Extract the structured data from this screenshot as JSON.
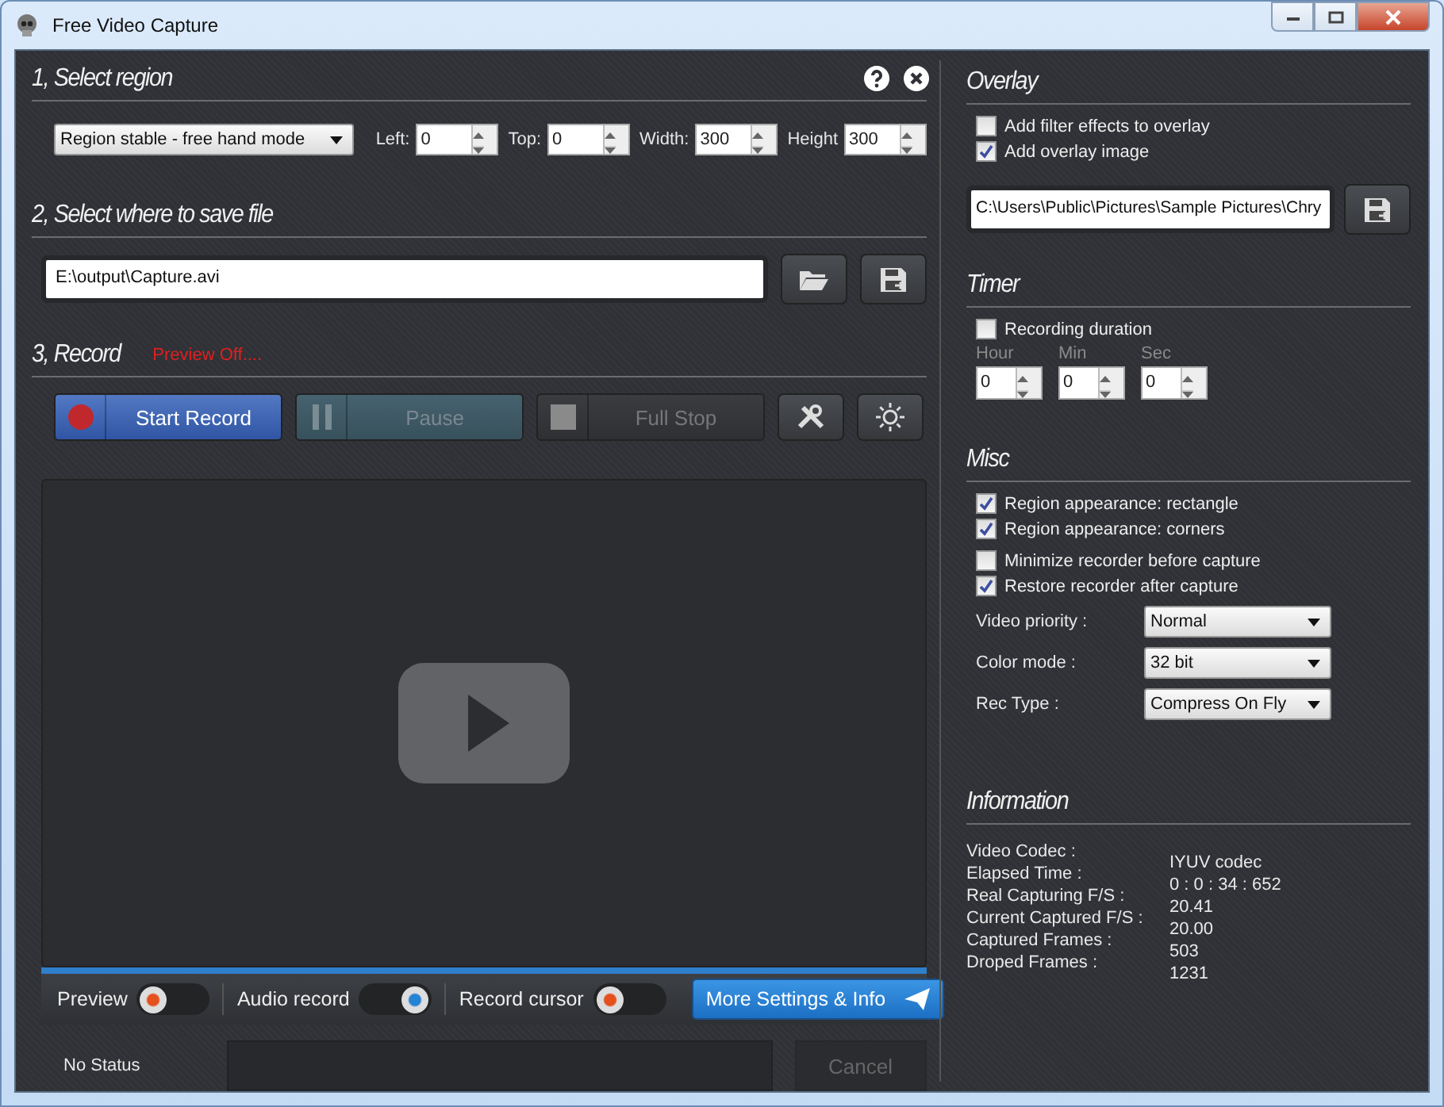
{
  "window": {
    "title": "Free Video Capture"
  },
  "region": {
    "heading": "1, Select region",
    "mode": "Region stable - free hand mode",
    "fields": [
      {
        "label": "Left:",
        "value": "0"
      },
      {
        "label": "Top:",
        "value": "0"
      },
      {
        "label": "Width:",
        "value": "300"
      },
      {
        "label": "Height",
        "value": "300"
      }
    ]
  },
  "save": {
    "heading": "2, Select where to save file",
    "path": "E:\\output\\Capture.avi"
  },
  "record": {
    "heading": "3, Record",
    "note": "Preview Off....",
    "buttons": [
      {
        "label": "Start Record",
        "kind": "record",
        "disabled": false
      },
      {
        "label": "Pause",
        "kind": "pause",
        "disabled": true
      },
      {
        "label": "Full Stop",
        "kind": "stop",
        "disabled": true
      }
    ],
    "toggles": [
      {
        "label": "Preview",
        "on": false
      },
      {
        "label": "Audio record",
        "on": true
      },
      {
        "label": "Record cursor",
        "on": false
      }
    ],
    "more_button": "More Settings & Info"
  },
  "status_bar": {
    "text": "No Status",
    "cancel": {
      "label": "Cancel",
      "disabled": true
    }
  },
  "overlay": {
    "heading": "Overlay",
    "options": [
      {
        "label": "Add filter effects to overlay",
        "checked": false
      },
      {
        "label": "Add overlay image",
        "checked": true
      }
    ],
    "image_path": "C:\\Users\\Public\\Pictures\\Sample Pictures\\Chry"
  },
  "timer": {
    "heading": "Timer",
    "option": {
      "label": "Recording duration",
      "checked": false
    },
    "fields": [
      {
        "label": "Hour",
        "value": "0",
        "disabled": true
      },
      {
        "label": "Min",
        "value": "0",
        "disabled": true
      },
      {
        "label": "Sec",
        "value": "0",
        "disabled": true
      }
    ]
  },
  "misc": {
    "heading": "Misc",
    "option_groups": [
      [
        {
          "label": "Region appearance: rectangle",
          "checked": true
        },
        {
          "label": "Region appearance: corners",
          "checked": true
        }
      ],
      [
        {
          "label": "Minimize recorder before capture",
          "checked": false
        },
        {
          "label": "Restore recorder after capture",
          "checked": true
        }
      ]
    ],
    "selects": [
      {
        "label": "Video priority :",
        "value": "Normal"
      },
      {
        "label": "Color mode :",
        "value": "32 bit"
      },
      {
        "label": "Rec Type :",
        "value": "Compress On Fly"
      }
    ]
  },
  "information": {
    "heading": "Information",
    "labels": [
      "Video Codec :",
      "Elapsed Time :",
      "Real Capturing F/S :",
      "Current Captured F/S :",
      "Captured Frames :",
      "Droped Frames :"
    ],
    "values": [
      "IYUV codec",
      "0 : 0 : 34 : 652",
      "20.41",
      "20.00",
      "503",
      "1231"
    ]
  }
}
